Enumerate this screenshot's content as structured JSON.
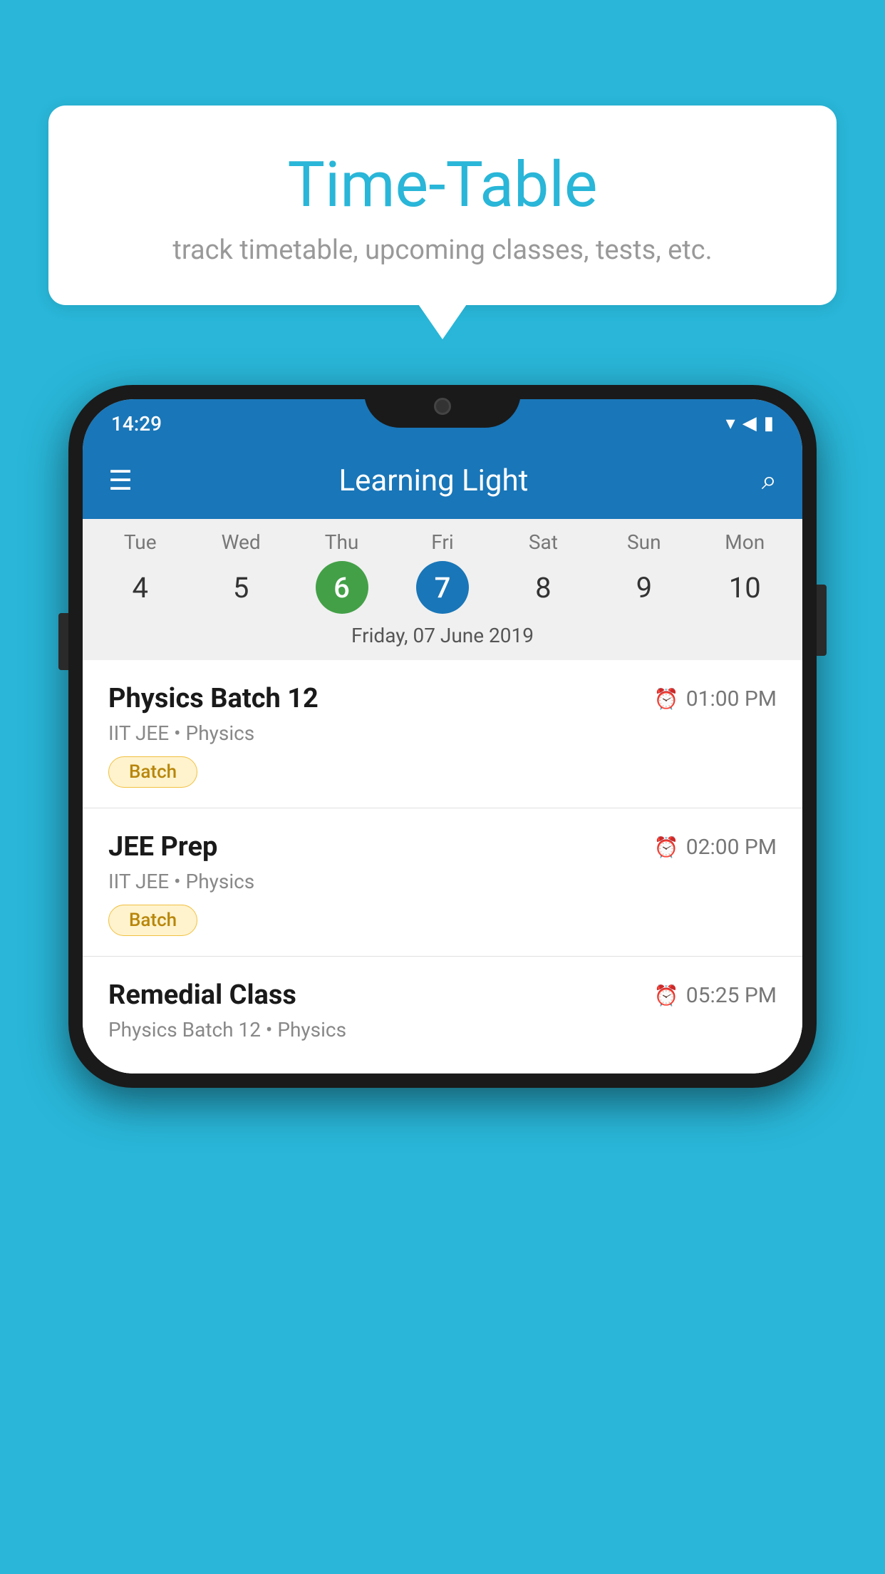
{
  "background": {
    "color": "#29b6d8"
  },
  "speech_bubble": {
    "title": "Time-Table",
    "subtitle": "track timetable, upcoming classes, tests, etc."
  },
  "phone": {
    "status_bar": {
      "time": "14:29"
    },
    "app_bar": {
      "title": "Learning Light"
    },
    "calendar": {
      "days": [
        {
          "name": "Tue",
          "number": "4",
          "state": "normal"
        },
        {
          "name": "Wed",
          "number": "5",
          "state": "normal"
        },
        {
          "name": "Thu",
          "number": "6",
          "state": "today"
        },
        {
          "name": "Fri",
          "number": "7",
          "state": "selected"
        },
        {
          "name": "Sat",
          "number": "8",
          "state": "normal"
        },
        {
          "name": "Sun",
          "number": "9",
          "state": "normal"
        },
        {
          "name": "Mon",
          "number": "10",
          "state": "normal"
        }
      ],
      "selected_date_label": "Friday, 07 June 2019"
    },
    "schedule": [
      {
        "title": "Physics Batch 12",
        "time": "01:00 PM",
        "subtitle": "IIT JEE • Physics",
        "badge": "Batch"
      },
      {
        "title": "JEE Prep",
        "time": "02:00 PM",
        "subtitle": "IIT JEE • Physics",
        "badge": "Batch"
      },
      {
        "title": "Remedial Class",
        "time": "05:25 PM",
        "subtitle": "Physics Batch 12 • Physics",
        "badge": null
      }
    ]
  }
}
